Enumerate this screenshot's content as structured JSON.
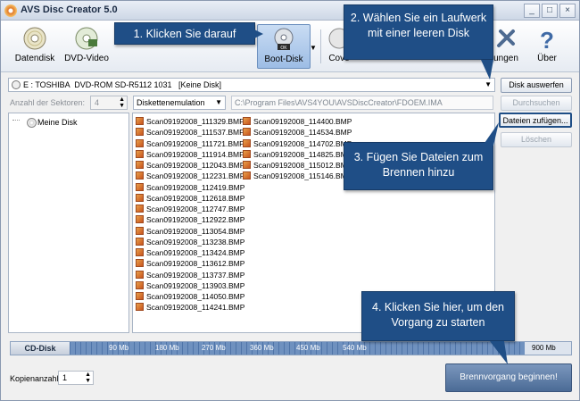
{
  "window": {
    "title": "AVS Disc Creator 5.0",
    "min": "_",
    "max": "□",
    "close": "×"
  },
  "toolbar": [
    {
      "label": "Datendisk",
      "icon": "data-disc-icon"
    },
    {
      "label": "DVD-Video",
      "icon": "dvd-video-icon"
    },
    {
      "label": "Boot-Disk",
      "icon": "boot-disk-icon",
      "active": true
    },
    {
      "label": "Cove",
      "icon": "cover-icon"
    },
    {
      "label": "ungen",
      "icon": "settings-icon"
    },
    {
      "label": "Über",
      "icon": "help-icon"
    }
  ],
  "drive": {
    "name": "E : TOSHIBA  DVD-ROM SD-R5112 1031",
    "status": "[Keine Disk]"
  },
  "buttons": {
    "eject": "Disk auswerfen",
    "browse": "Durchsuchen",
    "add_files": "Dateien zufügen...",
    "delete": "Löschen",
    "burn": "Brennvorgang beginnen!"
  },
  "sectors": {
    "label": "Anzahl der Sektoren:",
    "value": "4"
  },
  "emulation": {
    "value": "Diskettenemulation"
  },
  "image_path": "C:\\Program Files\\AVS4YOU\\AVSDiscCreator\\FDOEM.IMA",
  "tree": {
    "root": "Meine Disk"
  },
  "files_col1": [
    "Scan09192008_111329.BMP",
    "Scan09192008_111537.BMP",
    "Scan09192008_111721.BMP",
    "Scan09192008_111914.BMP",
    "Scan09192008_112043.BMP",
    "Scan09192008_112231.BMP",
    "Scan09192008_112419.BMP",
    "Scan09192008_112618.BMP",
    "Scan09192008_112747.BMP",
    "Scan09192008_112922.BMP",
    "Scan09192008_113054.BMP",
    "Scan09192008_113238.BMP",
    "Scan09192008_113424.BMP",
    "Scan09192008_113612.BMP",
    "Scan09192008_113737.BMP",
    "Scan09192008_113903.BMP",
    "Scan09192008_114050.BMP",
    "Scan09192008_114241.BMP"
  ],
  "files_col2": [
    "Scan09192008_114400.BMP",
    "Scan09192008_114534.BMP",
    "Scan09192008_114702.BMP",
    "Scan09192008_114825.BMP",
    "Scan09192008_115012.BMP",
    "Scan09192008_115146.BMP"
  ],
  "capacity": {
    "disk_type": "CD-Disk",
    "ticks": [
      "90 Mb",
      "180 Mb",
      "270 Mb",
      "360 Mb",
      "450 Mb",
      "540 Mb"
    ],
    "end_tick": "900 Mb"
  },
  "copies": {
    "label": "Kopienanzahl:",
    "value": "1"
  },
  "callouts": {
    "c1": "1. Klicken Sie darauf",
    "c2": "2. Wählen Sie ein Laufwerk mit einer leeren Disk",
    "c3": "3. Fügen Sie Dateien zum Brennen hinzu",
    "c4": "4. Klicken Sie hier, um den Vorgang zu starten"
  },
  "colors": {
    "callout": "#1f4e86",
    "accent": "#5a7eb0"
  }
}
